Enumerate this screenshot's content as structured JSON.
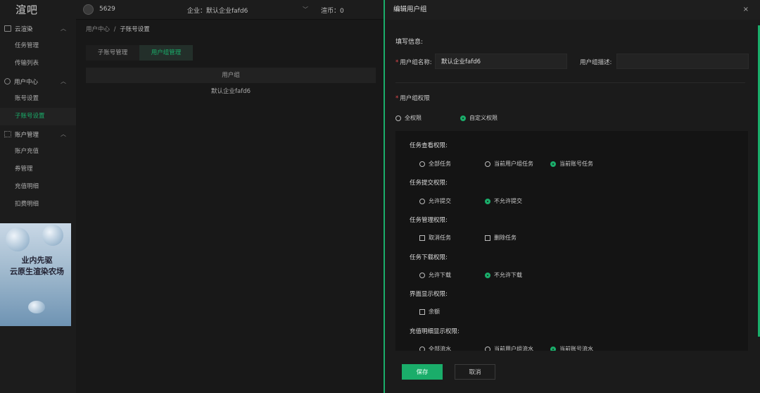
{
  "logo": "渲吧",
  "topbar": {
    "uid": "5629",
    "company": "企业：默认企业fafd6",
    "points": "渲币：0"
  },
  "sidebar": {
    "groups": [
      {
        "label": "云渲染",
        "items": [
          "任务管理",
          "传输列表"
        ]
      },
      {
        "label": "用户中心",
        "items": [
          "账号设置",
          "子账号设置"
        ]
      },
      {
        "label": "账户管理",
        "items": [
          "账户充值",
          "券管理",
          "充值明细",
          "扣费明细"
        ]
      }
    ],
    "banner": {
      "line1": "业内先驱",
      "line2": "云原生渲染农场"
    }
  },
  "breadcrumb": {
    "root": "用户中心",
    "sep": "/",
    "current": "子账号设置"
  },
  "tabs": [
    "子账号管理",
    "用户组管理"
  ],
  "table": {
    "header": "用户组",
    "rows": [
      "默认企业fafd6"
    ]
  },
  "dialog": {
    "title": "编辑用户组",
    "close": "×",
    "section": "填写信息:",
    "name_label": "用户组名称:",
    "name_value": "默认企业fafd6",
    "desc_label": "用户组描述:",
    "desc_value": "",
    "perm_title": "用户组权限",
    "perm_modes": [
      "全权限",
      "自定义权限"
    ],
    "permissions": [
      {
        "title": "任务查看权限:",
        "kind": "radio",
        "options": [
          "全部任务",
          "当前用户组任务",
          "当前账号任务"
        ],
        "selected": 2
      },
      {
        "title": "任务提交权限:",
        "kind": "radio",
        "options": [
          "允许提交",
          "不允许提交"
        ],
        "selected": 1
      },
      {
        "title": "任务管理权限:",
        "kind": "checkbox",
        "options": [
          "取消任务",
          "删除任务"
        ]
      },
      {
        "title": "任务下载权限:",
        "kind": "radio",
        "options": [
          "允许下载",
          "不允许下载"
        ],
        "selected": 1
      },
      {
        "title": "界面显示权限:",
        "kind": "checkbox",
        "options": [
          "余额"
        ]
      },
      {
        "title": "充值明细显示权限:",
        "kind": "radio",
        "options": [
          "全部流水",
          "当前用户组流水",
          "当前账号流水"
        ],
        "selected": 2
      }
    ],
    "save": "保存",
    "cancel": "取消"
  },
  "colors": {
    "accent": "#1aad6a",
    "required": "#e5484d"
  }
}
